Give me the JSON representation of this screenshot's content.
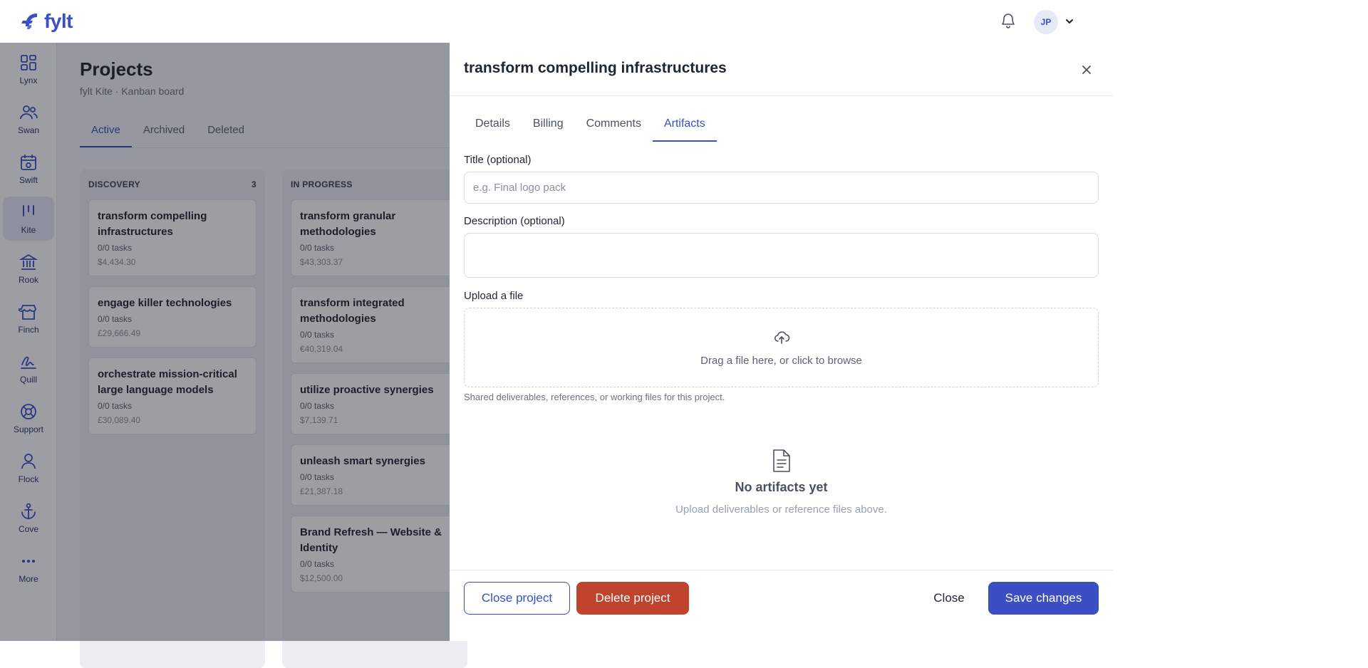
{
  "brand": {
    "name": "fylt",
    "color": "#3a4fc4"
  },
  "header": {
    "avatar_initials": "JP",
    "bell_icon": "bell-icon",
    "chevron_icon": "chevron-down-icon"
  },
  "rail": {
    "items": [
      {
        "label": "Lynx",
        "icon": "grid-icon"
      },
      {
        "label": "Swan",
        "icon": "users-icon"
      },
      {
        "label": "Swift",
        "icon": "calendar-icon"
      },
      {
        "label": "Kite",
        "icon": "kanban-icon",
        "active": true
      },
      {
        "label": "Rook",
        "icon": "bank-icon"
      },
      {
        "label": "Finch",
        "icon": "store-icon"
      },
      {
        "label": "Quill",
        "icon": "signature-icon"
      },
      {
        "label": "Support",
        "icon": "lifebuoy-icon"
      },
      {
        "label": "Flock",
        "icon": "user-icon"
      },
      {
        "label": "Cove",
        "icon": "anchor-icon"
      },
      {
        "label": "More",
        "icon": "dots-icon"
      }
    ]
  },
  "page": {
    "title": "Projects",
    "subtitle": "fylt Kite · Kanban board",
    "tabs": [
      "Active",
      "Archived",
      "Deleted"
    ]
  },
  "board": {
    "columns": [
      {
        "name": "DISCOVERY",
        "count": "3",
        "cards": [
          {
            "title": "transform compelling infrastructures",
            "tasks": "0/0 tasks",
            "amount": "$4,434.30"
          },
          {
            "title": "engage killer technologies",
            "tasks": "0/0 tasks",
            "amount": "£29,666.49"
          },
          {
            "title": "orchestrate mission-critical large language models",
            "tasks": "0/0 tasks",
            "amount": "£30,089.40"
          }
        ]
      },
      {
        "name": "IN PROGRESS",
        "count": "",
        "cards": [
          {
            "title": "transform granular methodologies",
            "tasks": "0/0 tasks",
            "amount": "$43,303.37"
          },
          {
            "title": "transform integrated methodologies",
            "tasks": "0/0 tasks",
            "amount": "€40,319.04"
          },
          {
            "title": "utilize proactive synergies",
            "tasks": "0/0 tasks",
            "amount": "$7,139.71"
          },
          {
            "title": "unleash smart synergies",
            "tasks": "0/0 tasks",
            "amount": "£21,387.18"
          },
          {
            "title": "Brand Refresh — Website & Identity",
            "tasks": "0/0 tasks",
            "amount": "$12,500.00"
          }
        ]
      }
    ]
  },
  "drawer": {
    "title": "transform compelling infrastructures",
    "tabs": [
      "Details",
      "Billing",
      "Comments",
      "Artifacts"
    ],
    "active_tab": "Artifacts",
    "form": {
      "title_label": "Title (optional)",
      "title_placeholder": "e.g. Final logo pack",
      "title_value": "",
      "description_label": "Description (optional)",
      "description_value": "",
      "upload_label": "Upload a file",
      "dropzone_text": "Drag a file here, or click to browse",
      "hint": "Shared deliverables, references, or working files for this project."
    },
    "empty": {
      "title": "No artifacts yet",
      "subtitle": "Upload deliverables or reference files above."
    },
    "footer": {
      "close_project": "Close project",
      "delete_project": "Delete project",
      "close": "Close",
      "save": "Save changes"
    }
  },
  "colors": {
    "primary": "#3a4fc4",
    "danger": "#c0432e"
  }
}
